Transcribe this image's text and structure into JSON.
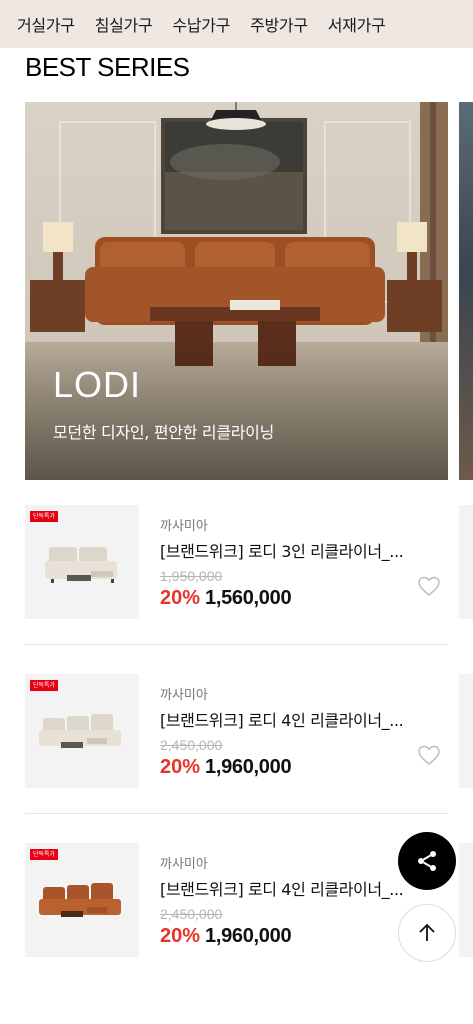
{
  "categories": [
    "거실가구",
    "침실가구",
    "수납가구",
    "주방가구",
    "서재가구"
  ],
  "section_title": "BEST SERIES",
  "hero": {
    "name": "LODI",
    "subtitle": "모던한 디자인, 편안한 리클라이닝"
  },
  "products": [
    {
      "badge": "단독특가",
      "brand": "까사미아",
      "name": "[브랜드위크] 로디 3인 리클라이너_...",
      "original_price": "1,950,000",
      "discount_rate": "20%",
      "price": "1,560,000",
      "color": "#e3ddd3"
    },
    {
      "badge": "단독특가",
      "brand": "까사미아",
      "name": "[브랜드위크] 로디 4인 리클라이너_...",
      "original_price": "2,450,000",
      "discount_rate": "20%",
      "price": "1,960,000",
      "color": "#e3ddd3"
    },
    {
      "badge": "단독특가",
      "brand": "까사미아",
      "name": "[브랜드위크] 로디 4인 리클라이너_...",
      "original_price": "2,450,000",
      "discount_rate": "20%",
      "price": "1,960,000",
      "color": "#a9542b"
    }
  ],
  "icons": {
    "wishlist": "heart-icon",
    "share": "share-icon",
    "scroll_top": "arrow-up-icon"
  },
  "colors": {
    "category_bar": "#efe7e1",
    "discount": "#e8332b",
    "badge": "#e60012"
  }
}
